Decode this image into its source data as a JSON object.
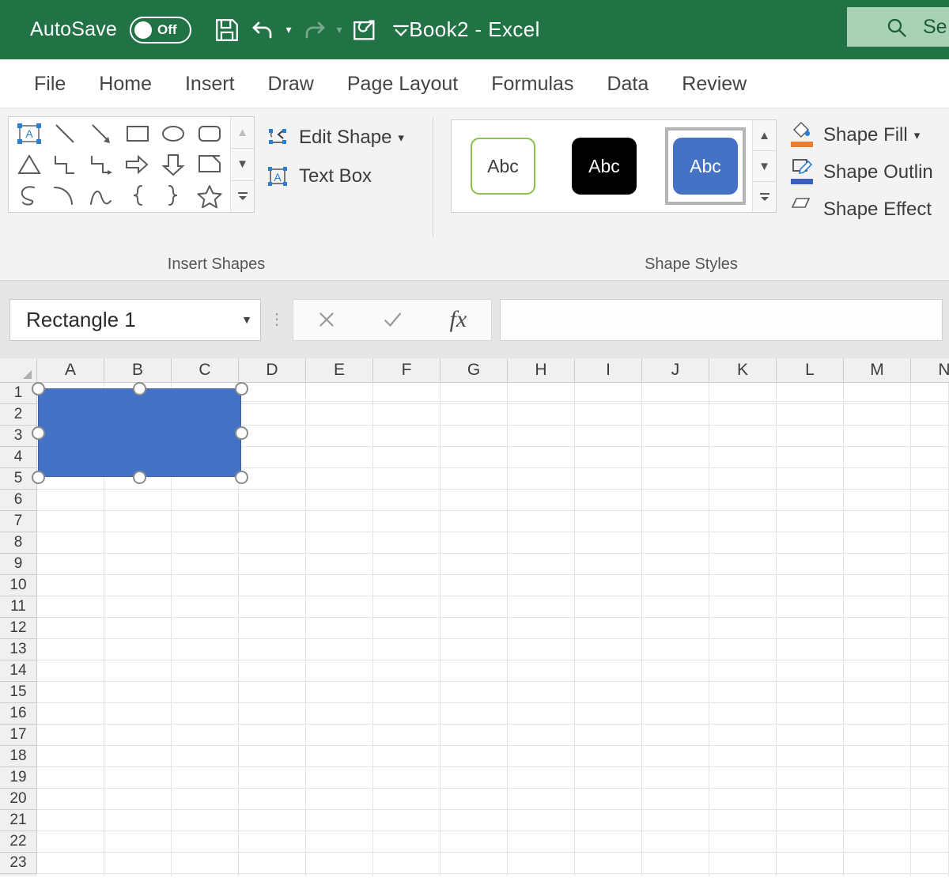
{
  "titlebar": {
    "autosave_label": "AutoSave",
    "autosave_state": "Off",
    "document_title": "Book2  -  Excel",
    "save_icon": "save-icon",
    "undo_icon": "undo-icon",
    "redo_icon": "redo-icon",
    "touch_mode_icon": "touch-draw-icon",
    "customize_qat_icon": "customize-quick-access-toolbar-icon",
    "search_placeholder": "Se",
    "search_icon": "search-icon",
    "green": "#217346",
    "search_bg": "#a8d1b5"
  },
  "tabs": [
    {
      "label": "File"
    },
    {
      "label": "Home"
    },
    {
      "label": "Insert"
    },
    {
      "label": "Draw"
    },
    {
      "label": "Page Layout"
    },
    {
      "label": "Formulas"
    },
    {
      "label": "Data"
    },
    {
      "label": "Review"
    }
  ],
  "ribbon": {
    "insert_shapes": {
      "group_label": "Insert Shapes",
      "gallery_shapes": [
        "text-box-shape",
        "line-shape",
        "line-arrow-shape",
        "rectangle-shape",
        "oval-shape",
        "rounded-rectangle-shape",
        "isosceles-triangle-shape",
        "elbow-connector-shape",
        "elbow-arrow-connector-shape",
        "right-arrow-shape",
        "down-arrow-shape",
        "folded-corner-shape",
        "scribble-shape",
        "arc-shape",
        "curve-shape",
        "left-brace-shape",
        "right-brace-shape",
        "five-point-star-shape"
      ],
      "scroll_up_icon": "chevron-up-icon",
      "scroll_down_icon": "chevron-down-icon",
      "more_icon": "gallery-more-icon",
      "edit_shape_label": "Edit Shape",
      "edit_shape_icon": "edit-shape-icon",
      "text_box_label": "Text Box",
      "text_box_icon": "text-box-icon"
    },
    "shape_styles": {
      "group_label": "Shape Styles",
      "samples": [
        {
          "text": "Abc",
          "style": "outline-green"
        },
        {
          "text": "Abc",
          "style": "filled-black"
        },
        {
          "text": "Abc",
          "style": "filled-blue",
          "selected": true
        }
      ],
      "scroll_up_icon": "chevron-up-icon",
      "scroll_down_icon": "chevron-down-icon",
      "more_icon": "gallery-more-icon",
      "shape_fill_label": "Shape Fill",
      "shape_fill_icon": "shape-fill-icon",
      "shape_fill_color": "#ed7d31",
      "shape_outline_label": "Shape Outlin",
      "shape_outline_icon": "shape-outline-icon",
      "shape_outline_color": "#3b5fc0",
      "shape_effects_label": "Shape Effect",
      "shape_effects_icon": "shape-effects-icon"
    }
  },
  "formula_bar": {
    "name_box_value": "Rectangle 1",
    "name_box_caret_icon": "chevron-down-icon",
    "grip_icon": "vertical-dots-icon",
    "cancel_icon": "cancel-icon",
    "enter_icon": "enter-check-icon",
    "function_icon": "insert-function-icon",
    "function_label": "fx",
    "formula_value": "",
    "formula_placeholder": ""
  },
  "grid": {
    "columns": [
      "A",
      "B",
      "C",
      "D",
      "E",
      "F",
      "G",
      "H",
      "I",
      "J",
      "K",
      "L",
      "M",
      "N"
    ],
    "rows": [
      1,
      2,
      3,
      4,
      5,
      6,
      7,
      8,
      9,
      10,
      11,
      12,
      13,
      14,
      15,
      16,
      17,
      18,
      19,
      20,
      21,
      22,
      23
    ],
    "select_all_icon": "select-all-corner-icon",
    "shape": {
      "name": "Rectangle 1",
      "fill_color": "#4472c4",
      "outline_color": "#41619e",
      "selected": true,
      "handle_count": 8
    }
  }
}
